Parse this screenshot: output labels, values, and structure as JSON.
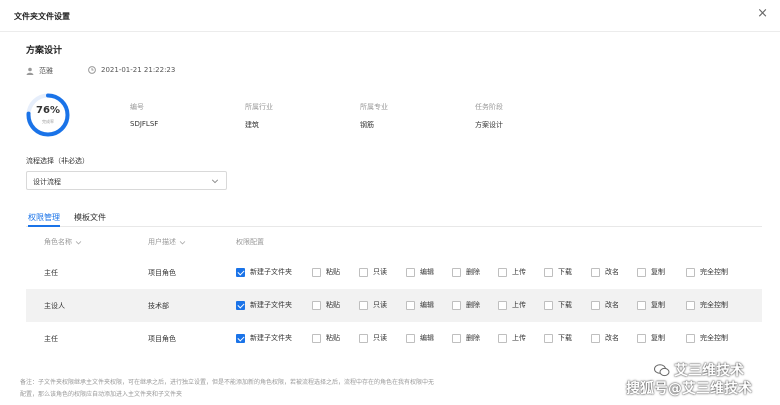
{
  "dialog": {
    "title": "文件夹文件设置",
    "close_icon": "×"
  },
  "project": {
    "title": "方案设计",
    "user": "范雅",
    "datetime": "2021-01-21 21:22:23",
    "progress_percent": 76,
    "progress_label": "76%",
    "progress_sub": "完成率",
    "info": [
      {
        "label": "编号",
        "value": "SDJFLSF"
      },
      {
        "label": "所属行业",
        "value": "建筑"
      },
      {
        "label": "所属专业",
        "value": "钢筋"
      },
      {
        "label": "任务阶段",
        "value": "方案设计"
      }
    ]
  },
  "flow": {
    "label": "流程选择（非必选）",
    "value": "设计流程"
  },
  "tabs": [
    {
      "label": "权限管理",
      "active": true
    },
    {
      "label": "模板文件",
      "active": false
    }
  ],
  "table": {
    "headers": {
      "role": "角色名称",
      "desc": "用户描述",
      "perm": "权限配置"
    },
    "permissions": [
      "新建子文件夹",
      "粘贴",
      "只读",
      "编辑",
      "删除",
      "上传",
      "下载",
      "改名",
      "复制",
      "完全控制"
    ],
    "rows": [
      {
        "role": "主任",
        "desc": "项目角色",
        "checked": [
          true,
          false,
          false,
          false,
          false,
          false,
          false,
          false,
          false,
          false
        ]
      },
      {
        "role": "主设人",
        "desc": "技术部",
        "checked": [
          true,
          false,
          false,
          false,
          false,
          false,
          false,
          false,
          false,
          false
        ]
      },
      {
        "role": "主任",
        "desc": "项目角色",
        "checked": [
          true,
          false,
          false,
          false,
          false,
          false,
          false,
          false,
          false,
          false
        ]
      }
    ]
  },
  "note": {
    "line1": "备注：子文件夹权限继承主文件夹权限，可在继承之后，进行独立设置，但是不能添加新的角色权限，若被流程选择之后，流程中存在的角色在我有权限中无",
    "line2": "配置，那么该角色的权限应自动添加进入主文件夹和子文件夹"
  },
  "watermark": {
    "line1": "艾三维技术",
    "line2": "搜狐号@艾三维技术"
  },
  "colors": {
    "accent": "#1a73e8",
    "progress_track": "#e6eefb",
    "row_shade": "#f2f2f2"
  }
}
